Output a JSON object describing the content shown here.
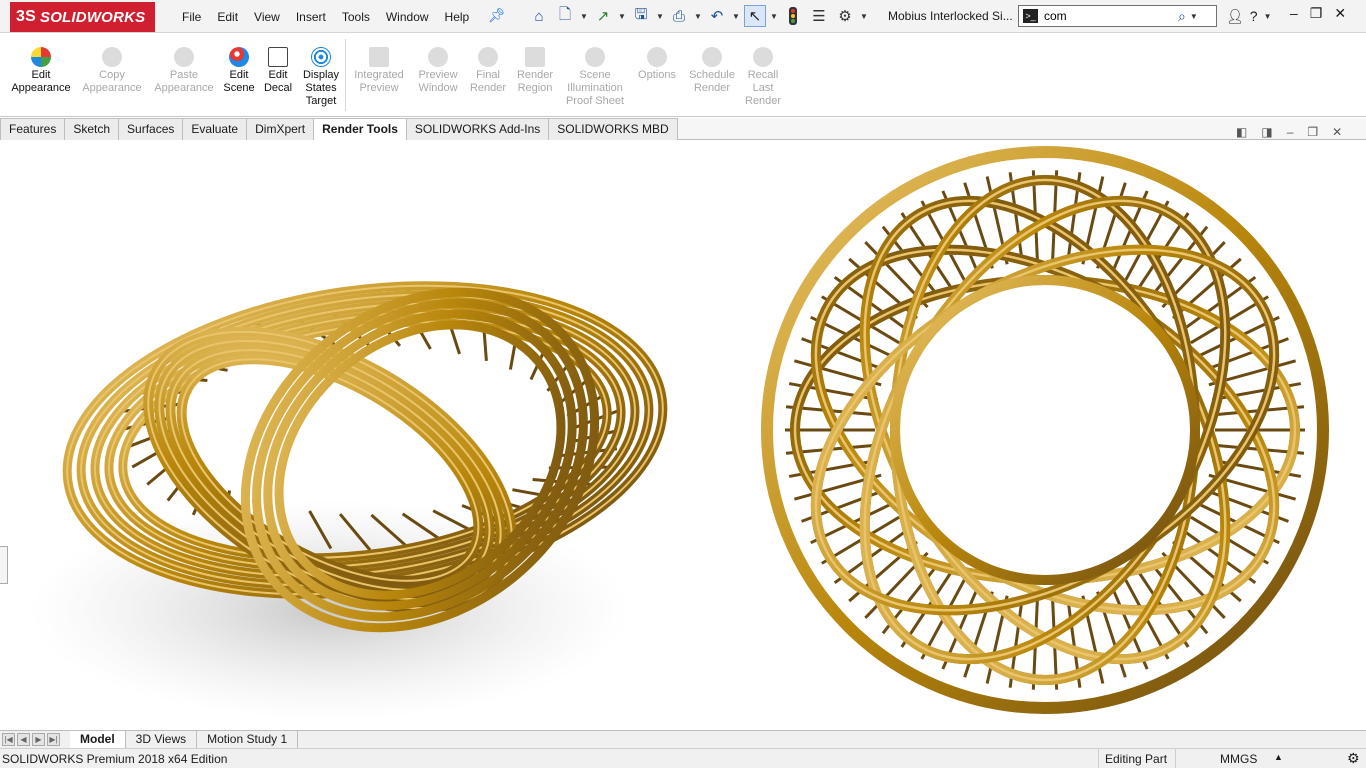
{
  "app": {
    "logo_text": "SOLIDWORKS",
    "logo_prefix": "3S",
    "document_title": "Mobius Interlocked Si...",
    "brand_color": "#d01f2e"
  },
  "menu": [
    "File",
    "Edit",
    "View",
    "Insert",
    "Tools",
    "Window",
    "Help"
  ],
  "quickbar": {
    "icons": [
      "home-icon",
      "new-document-icon",
      "open-icon",
      "save-icon",
      "print-icon",
      "undo-icon",
      "select-icon",
      "rebuild-icon",
      "file-properties-icon",
      "options-gear-icon"
    ]
  },
  "search": {
    "value": "com"
  },
  "ribbon": {
    "buttons": [
      {
        "label_lines": [
          "Edit",
          "Appearance"
        ],
        "enabled": true
      },
      {
        "label_lines": [
          "Copy",
          "Appearance"
        ],
        "enabled": false
      },
      {
        "label_lines": [
          "Paste",
          "Appearance"
        ],
        "enabled": false
      },
      {
        "label_lines": [
          "Edit",
          "Scene"
        ],
        "enabled": true
      },
      {
        "label_lines": [
          "Edit",
          "Decal"
        ],
        "enabled": true
      },
      {
        "label_lines": [
          "Display",
          "States",
          "Target"
        ],
        "enabled": true
      },
      {
        "label_lines": [
          "Integrated",
          "Preview"
        ],
        "enabled": false
      },
      {
        "label_lines": [
          "Preview",
          "Window"
        ],
        "enabled": false
      },
      {
        "label_lines": [
          "Final",
          "Render"
        ],
        "enabled": false
      },
      {
        "label_lines": [
          "Render",
          "Region"
        ],
        "enabled": false
      },
      {
        "label_lines": [
          "Scene",
          "Illumination",
          "Proof Sheet"
        ],
        "enabled": false
      },
      {
        "label_lines": [
          "Options"
        ],
        "enabled": false
      },
      {
        "label_lines": [
          "Schedule",
          "Render"
        ],
        "enabled": false
      },
      {
        "label_lines": [
          "Recall",
          "Last",
          "Render"
        ],
        "enabled": false
      }
    ]
  },
  "tabs": [
    {
      "label": "Features",
      "active": false
    },
    {
      "label": "Sketch",
      "active": false
    },
    {
      "label": "Surfaces",
      "active": false
    },
    {
      "label": "Evaluate",
      "active": false
    },
    {
      "label": "DimXpert",
      "active": false
    },
    {
      "label": "Render Tools",
      "active": true
    },
    {
      "label": "SOLIDWORKS Add-Ins",
      "active": false
    },
    {
      "label": "SOLIDWORKS MBD",
      "active": false
    }
  ],
  "model": {
    "color_light": "#e9c46a",
    "color_mid": "#b8860b",
    "color_dark": "#6b4a12"
  },
  "bottom_tabs": [
    {
      "label": "Model",
      "active": true
    },
    {
      "label": "3D Views",
      "active": false
    },
    {
      "label": "Motion Study 1",
      "active": false
    }
  ],
  "status": {
    "edition": "SOLIDWORKS Premium 2018 x64 Edition",
    "mode": "Editing Part",
    "units": "MMGS"
  }
}
